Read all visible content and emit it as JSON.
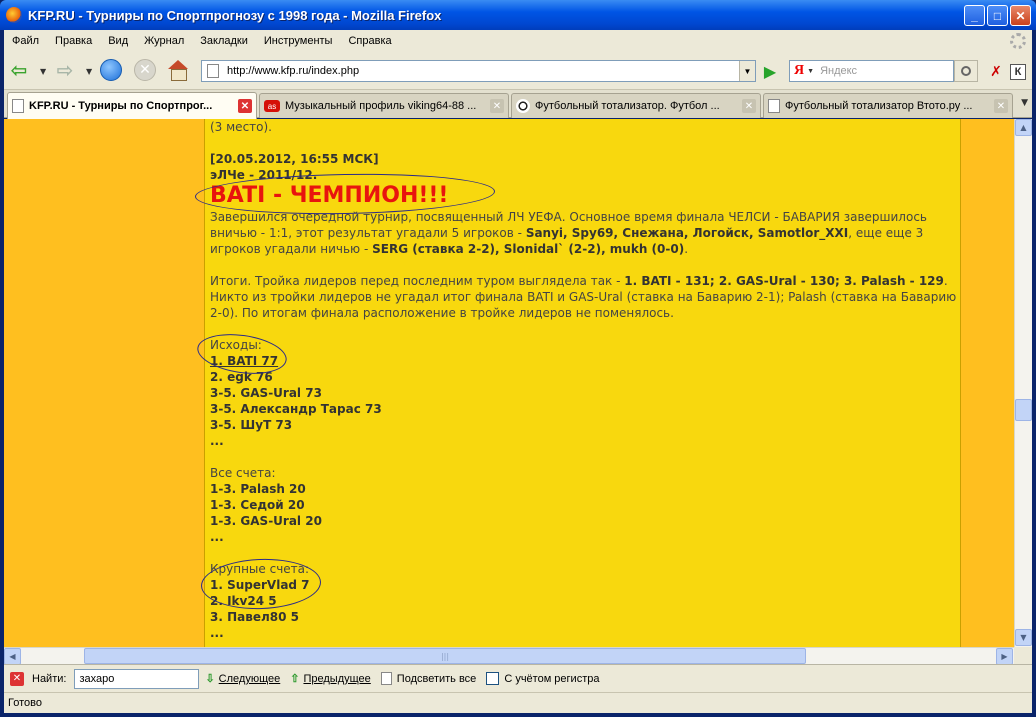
{
  "window": {
    "title": "KFP.RU - Турниры по Спортпрогнозу с 1998 года - Mozilla Firefox"
  },
  "menu": [
    "Файл",
    "Правка",
    "Вид",
    "Журнал",
    "Закладки",
    "Инструменты",
    "Справка"
  ],
  "nav": {
    "url": "http://www.kfp.ru/index.php",
    "search_engine_label": "Я",
    "search_placeholder": "Яндекс",
    "ext_label": "К"
  },
  "tabs": [
    {
      "label": "KFP.RU - Турниры по Спортпрог...",
      "active": true
    },
    {
      "label": "Музыкальный профиль viking64-88 ...",
      "active": false
    },
    {
      "label": "Футбольный тотализатор. Футбол ...",
      "active": false
    },
    {
      "label": "Футбольный тотализатор Втото.ру ...",
      "active": false
    }
  ],
  "article": {
    "prev_line": "(3 место).",
    "date": "[20.05.2012, 16:55 МСК]",
    "tournament": "эЛЧе - 2011/12.",
    "headline": "BATI - ЧЕМПИОН!!!",
    "p1": {
      "a": "Завершился очередной турнир, посвященный ЛЧ УЕФА. Основное время финала ЧЕЛСИ - БАВАРИЯ завершилось вничью - 1:1, этот результат угадали 5 игроков - ",
      "b": "Sanyi, Spy69, Снежана, Логойск, Samotlor_XXI",
      "c": ", еще еще 3 игроков угадали ничью - ",
      "d": "SERG (ставка 2-2), Slonidal` (2-2), mukh (0-0)",
      "e": "."
    },
    "p2": {
      "a": "Итоги. Тройка лидеров перед последним туром выглядела так - ",
      "b": "1. BATI - 131; 2. GAS-Ural - 130; 3. Palash - 129",
      "c": ". Никто из тройки лидеров не угадал итог финала BATI и GAS-Ural (ставка на Баварию 2-1); Palash (ставка на Баварию 2-0). По итогам финала расположение в тройке лидеров не поменялось."
    },
    "outcomes": {
      "title": "Исходы:",
      "items": [
        "1. BATI 77",
        "2. egk 76",
        "3-5. GAS-Ural 73",
        "3-5. Александр Тарас 73",
        "3-5. ШуТ 73"
      ],
      "more": "..."
    },
    "scores": {
      "title": "Все счета:",
      "items": [
        "1-3. Palash 20",
        "1-3. Седой 20",
        "1-3. GAS-Ural 20"
      ],
      "more": "..."
    },
    "big_scores": {
      "title": "Крупные счета:",
      "items": [
        "1. SuperVlad 7",
        "2. Ikv24 5",
        "3. Павел80 5"
      ],
      "more": "..."
    }
  },
  "findbar": {
    "label": "Найти:",
    "value": "захаро",
    "next": "Следующее",
    "prev": "Предыдущее",
    "highlight": "Подсветить все",
    "match_case": "С учётом регистра"
  },
  "status": {
    "text": "Готово"
  }
}
